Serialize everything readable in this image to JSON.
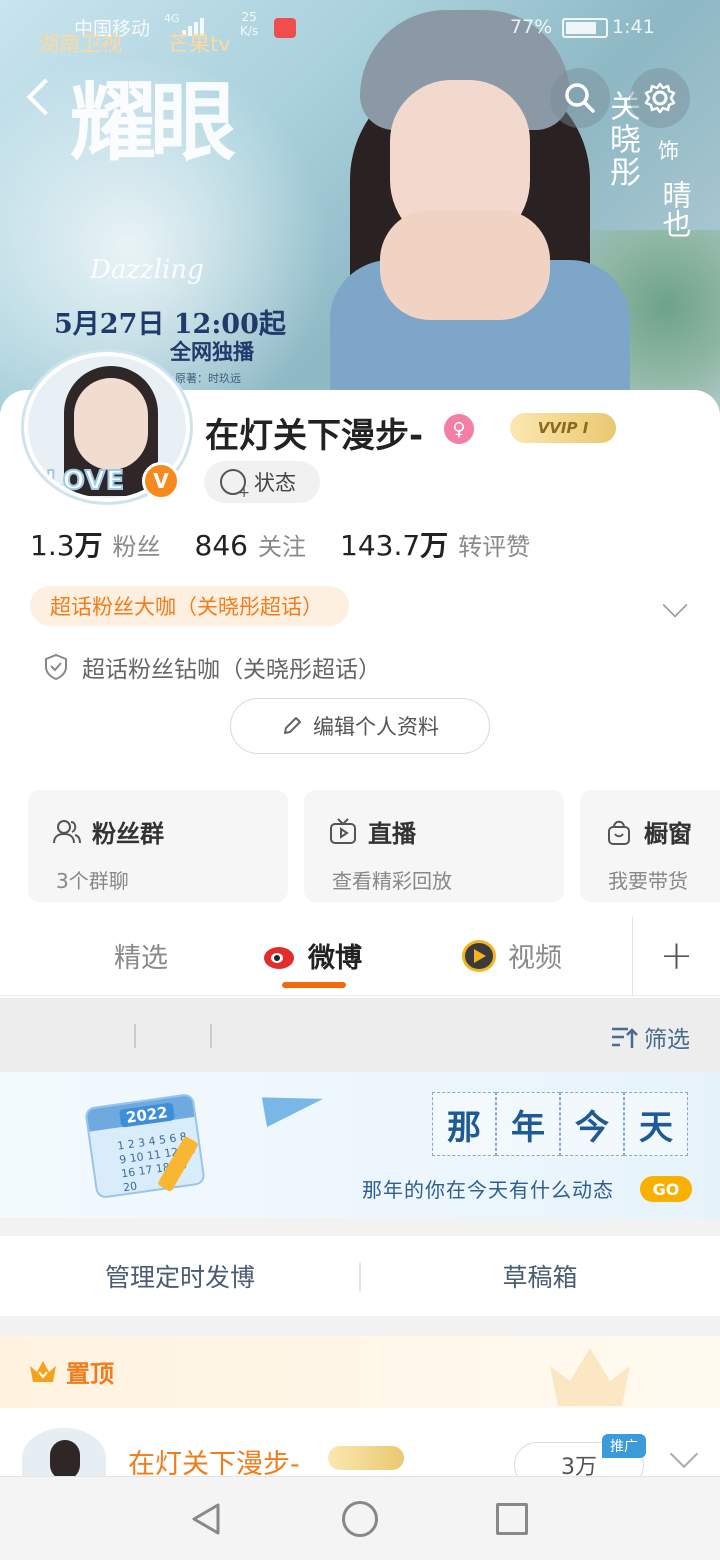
{
  "status_bar": {
    "carrier": "中国移动",
    "network": "4G",
    "speed_value": "25",
    "speed_unit": "K/s",
    "battery": "77%",
    "time": "1:41",
    "app_icon_1": "湖南卫视",
    "app_icon_2": "芒果tv"
  },
  "banner": {
    "title": "耀眼",
    "subtitle": "Dazzling",
    "release": "5月27日 12:00起",
    "exclusive": "全网独播",
    "credit": "原著：时玖远",
    "actor": "关晓彤",
    "as_label": "饰",
    "role": "晴也"
  },
  "profile": {
    "username": "在灯关下漫步-",
    "vip_label": "VVIP I",
    "status_label": "状态",
    "verified_mark": "V",
    "avatar_text": "LOVE",
    "stats": [
      {
        "num": "1.3",
        "unit": "万",
        "label": "粉丝"
      },
      {
        "num": "846",
        "unit": "",
        "label": "关注"
      },
      {
        "num": "143.7",
        "unit": "万",
        "label": "转评赞"
      }
    ],
    "fan_tag": "超话粉丝大咖（关晓彤超话）",
    "fan_tag_2": "超话粉丝钻咖（关晓彤超话）",
    "edit_button": "编辑个人资料"
  },
  "features": [
    {
      "title": "粉丝群",
      "sub": "3个群聊",
      "icon": "group-icon"
    },
    {
      "title": "直播",
      "sub": "查看精彩回放",
      "icon": "tv-icon"
    },
    {
      "title": "橱窗",
      "sub": "我要带货",
      "icon": "bag-icon"
    }
  ],
  "tabs": {
    "featured": "精选",
    "weibo": "微博",
    "video": "视频",
    "active": "weibo"
  },
  "filter": {
    "label": "筛选"
  },
  "memory": {
    "chars": [
      "那",
      "年",
      "今",
      "天"
    ],
    "caption": "那年的你在今天有什么动态",
    "go": "GO",
    "calendar_year": "2022",
    "calendar_days": "1 2 3 4 5 6 8 9 10 11 12 15 16 17 18 19 20"
  },
  "manage": {
    "scheduled": "管理定时发博",
    "drafts": "草稿箱"
  },
  "pinned": {
    "label": "置顶"
  },
  "post": {
    "author": "在灯关下漫步-",
    "follow_count": "3万",
    "promo_badge": "推广"
  },
  "colors": {
    "accent": "#f46a0a",
    "fan_tag_bg": "#fdf0e1",
    "fan_tag_text": "#f07d1a",
    "weibo_red": "#e32c2c",
    "link_blue": "#4a6a8e"
  }
}
